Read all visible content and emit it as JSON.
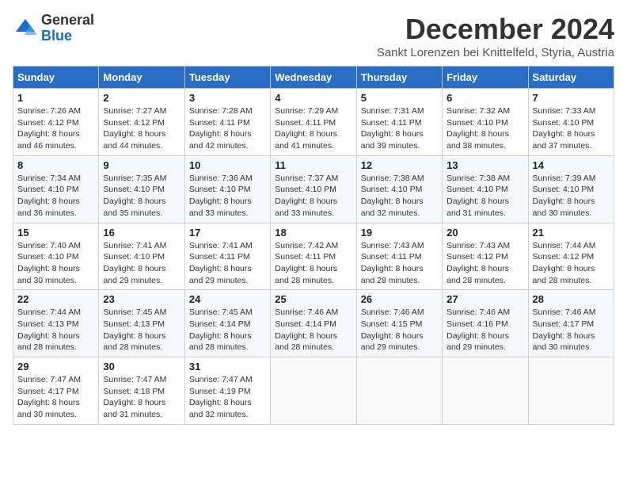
{
  "logo": {
    "general": "General",
    "blue": "Blue"
  },
  "title": "December 2024",
  "subtitle": "Sankt Lorenzen bei Knittelfeld, Styria, Austria",
  "days_header": [
    "Sunday",
    "Monday",
    "Tuesday",
    "Wednesday",
    "Thursday",
    "Friday",
    "Saturday"
  ],
  "weeks": [
    [
      {
        "day": "1",
        "sunrise": "7:26 AM",
        "sunset": "4:12 PM",
        "daylight": "8 hours and 46 minutes."
      },
      {
        "day": "2",
        "sunrise": "7:27 AM",
        "sunset": "4:12 PM",
        "daylight": "8 hours and 44 minutes."
      },
      {
        "day": "3",
        "sunrise": "7:28 AM",
        "sunset": "4:11 PM",
        "daylight": "8 hours and 42 minutes."
      },
      {
        "day": "4",
        "sunrise": "7:29 AM",
        "sunset": "4:11 PM",
        "daylight": "8 hours and 41 minutes."
      },
      {
        "day": "5",
        "sunrise": "7:31 AM",
        "sunset": "4:11 PM",
        "daylight": "8 hours and 39 minutes."
      },
      {
        "day": "6",
        "sunrise": "7:32 AM",
        "sunset": "4:10 PM",
        "daylight": "8 hours and 38 minutes."
      },
      {
        "day": "7",
        "sunrise": "7:33 AM",
        "sunset": "4:10 PM",
        "daylight": "8 hours and 37 minutes."
      }
    ],
    [
      {
        "day": "8",
        "sunrise": "7:34 AM",
        "sunset": "4:10 PM",
        "daylight": "8 hours and 36 minutes."
      },
      {
        "day": "9",
        "sunrise": "7:35 AM",
        "sunset": "4:10 PM",
        "daylight": "8 hours and 35 minutes."
      },
      {
        "day": "10",
        "sunrise": "7:36 AM",
        "sunset": "4:10 PM",
        "daylight": "8 hours and 33 minutes."
      },
      {
        "day": "11",
        "sunrise": "7:37 AM",
        "sunset": "4:10 PM",
        "daylight": "8 hours and 33 minutes."
      },
      {
        "day": "12",
        "sunrise": "7:38 AM",
        "sunset": "4:10 PM",
        "daylight": "8 hours and 32 minutes."
      },
      {
        "day": "13",
        "sunrise": "7:38 AM",
        "sunset": "4:10 PM",
        "daylight": "8 hours and 31 minutes."
      },
      {
        "day": "14",
        "sunrise": "7:39 AM",
        "sunset": "4:10 PM",
        "daylight": "8 hours and 30 minutes."
      }
    ],
    [
      {
        "day": "15",
        "sunrise": "7:40 AM",
        "sunset": "4:10 PM",
        "daylight": "8 hours and 30 minutes."
      },
      {
        "day": "16",
        "sunrise": "7:41 AM",
        "sunset": "4:10 PM",
        "daylight": "8 hours and 29 minutes."
      },
      {
        "day": "17",
        "sunrise": "7:41 AM",
        "sunset": "4:11 PM",
        "daylight": "8 hours and 29 minutes."
      },
      {
        "day": "18",
        "sunrise": "7:42 AM",
        "sunset": "4:11 PM",
        "daylight": "8 hours and 28 minutes."
      },
      {
        "day": "19",
        "sunrise": "7:43 AM",
        "sunset": "4:11 PM",
        "daylight": "8 hours and 28 minutes."
      },
      {
        "day": "20",
        "sunrise": "7:43 AM",
        "sunset": "4:12 PM",
        "daylight": "8 hours and 28 minutes."
      },
      {
        "day": "21",
        "sunrise": "7:44 AM",
        "sunset": "4:12 PM",
        "daylight": "8 hours and 28 minutes."
      }
    ],
    [
      {
        "day": "22",
        "sunrise": "7:44 AM",
        "sunset": "4:13 PM",
        "daylight": "8 hours and 28 minutes."
      },
      {
        "day": "23",
        "sunrise": "7:45 AM",
        "sunset": "4:13 PM",
        "daylight": "8 hours and 28 minutes."
      },
      {
        "day": "24",
        "sunrise": "7:45 AM",
        "sunset": "4:14 PM",
        "daylight": "8 hours and 28 minutes."
      },
      {
        "day": "25",
        "sunrise": "7:46 AM",
        "sunset": "4:14 PM",
        "daylight": "8 hours and 28 minutes."
      },
      {
        "day": "26",
        "sunrise": "7:46 AM",
        "sunset": "4:15 PM",
        "daylight": "8 hours and 29 minutes."
      },
      {
        "day": "27",
        "sunrise": "7:46 AM",
        "sunset": "4:16 PM",
        "daylight": "8 hours and 29 minutes."
      },
      {
        "day": "28",
        "sunrise": "7:46 AM",
        "sunset": "4:17 PM",
        "daylight": "8 hours and 30 minutes."
      }
    ],
    [
      {
        "day": "29",
        "sunrise": "7:47 AM",
        "sunset": "4:17 PM",
        "daylight": "8 hours and 30 minutes."
      },
      {
        "day": "30",
        "sunrise": "7:47 AM",
        "sunset": "4:18 PM",
        "daylight": "8 hours and 31 minutes."
      },
      {
        "day": "31",
        "sunrise": "7:47 AM",
        "sunset": "4:19 PM",
        "daylight": "8 hours and 32 minutes."
      },
      null,
      null,
      null,
      null
    ]
  ]
}
